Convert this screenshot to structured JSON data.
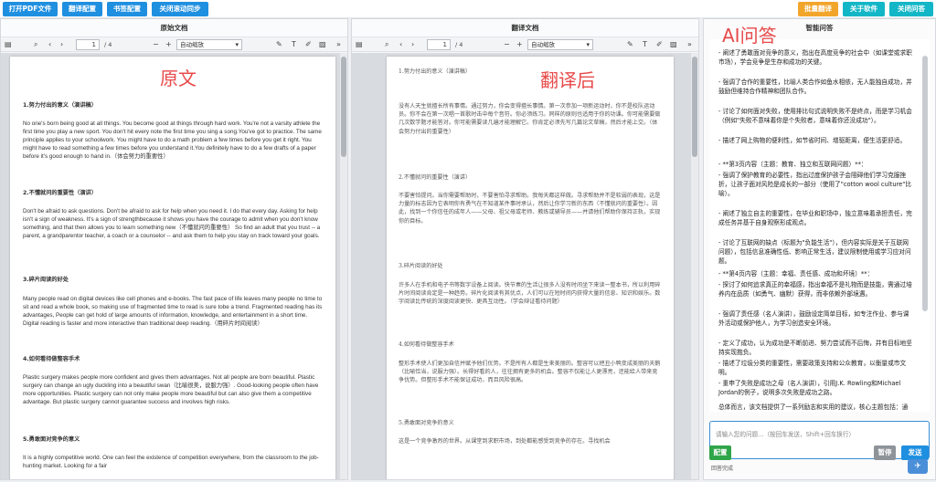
{
  "toolbar": {
    "open_pdf": "打开PDF文件",
    "translate_config": "翻译配置",
    "ai_config": "书签配置",
    "sync_scroll": "关闭滚动同步",
    "batch_translate": "批量翻译",
    "about": "关于软件",
    "close_qa": "关闭问答"
  },
  "panels": {
    "original_title": "原始文档",
    "translated_title": "翻译文档",
    "qa_title": "智能问答"
  },
  "viewer": {
    "page_number": "1",
    "page_total": "/ 4",
    "zoom": "自动缩放",
    "original_page_number": "1",
    "original_page_total": "/ 4",
    "original_zoom": "自动缩放"
  },
  "annotations": {
    "original_label": "原文",
    "translated_label": "翻译后",
    "ai_label": "AI问答"
  },
  "original_doc": {
    "h1": "1.努力付出的意义（演讲稿）",
    "p1": "No one's born being good at all things. You become good at things through hard work. You're not a varsity athlete the first time you play a new sport. You don't hit every note the first time you sing a song.You've got to practice. The same principle applies to your schoolwork. You might have to do a math problem a few times before you get it right. You might have to read something a few times before you understand it.You definitely have to do a few drafts of a paper before it's good enough to hand in.（体会努力的重要性）",
    "h2": "2.不懂就问的重要性（演讲）",
    "p2": "Don't be afraid to ask questions. Don't be afraid to ask for help when you need it. I do that every day. Asking for help isn't a sign of weakness. It's a sign of strengthbecause it shows you have the courage to admit when you don't know something, and that then allows you to learn something new（不懂就问的重要性） So find an adult that you trust -- a parent, a grandparentor teacher, a coach or a counselor -- and ask them to help you stay on track toward your goals.",
    "h3": "3.碎片阅读的好处",
    "p3": "Many people read on digital devices like cell phones and e-books. The fast pace of life leaves many people no time to sit and read a whole book, so making use of fragmented time to read is sure tobe a trend. Fragmented reading has its advantages, People can get hold of large amounts of information, knowledge, and entertainment in a short time. Digital reading is faster and more interactive than traditional deep reading.（用碎片时间阅读）",
    "h4": "4.如何看待做整容手术",
    "p4": "Plastic surgery makes people more confident and gives them advantages. Not all people are born beautiful. Plastic surgery can change an ugly duckling into a beautiful swan（比喻很美，说服力强）. Good-looking people often have more opportunities. Plastic surgery can not only make people more beautiful but can also give them a competitive advantage. But plastic surgery cannot guarantee success and involves high risks.",
    "h5": "5.勇敢面对竞争的意义",
    "p5": "It is a highly competitive world. One can feel the existence of competition everywhere, from the classroom to the job-hunting market. Looking for a fair"
  },
  "translated_doc": {
    "h1": "1.努力付出的意义（演讲稿）",
    "p1": "没有人天生就擅长所有事情。通过努力，你会变得擅长事情。第一次参加一项新运动时，你不是校队运动员。你不会在第一次唱一首歌时击中每个音符。你必须练习。同样的原则也适用于你的功课。你可能需要做几次数学题才能答对。你可能需要读几遍才能理解它。你肯定必须先写几篇论文草稿，然后才能上交。（体会努力付出的重要性）",
    "h2": "2.不懂就问的重要性（演讲）",
    "p2": "不要害怕提问。当你需要帮助时，不要害怕寻求帮助。我每天都这样做。寻求帮助并不是软弱的表现，这是力量的标志因为它表明你有勇气在不知道某件事时承认，然后让你学习新的东西（不懂就问的重要性）。因此，找到一个你信任的成年人——父母、祖父母或老师、教练或辅导员——并请他们帮助你保持正轨，实现你的目标。",
    "h3": "3.碎片阅读的好处",
    "p3": "许多人在手机和电子书等数字设备上阅读。快节奏的生活让很多人没有时间坐下来读一整本书，所以利用碎片时间阅读肯定是一种趋势。碎片化阅读有其优点，人们可以在短时间内获得大量的信息、知识和娱乐。数字阅读比传统的深度阅读更快、更具互动性。（学会辩证看待问题）",
    "h4": "4.如何看待做整容手术",
    "p4": "整形手术使人们更加自信并赋予他们优势。不是所有人都是生来美丽的。整容可以把丑小鸭变成美丽的天鹅（比喻恰当，说服力强）。长得好看的人，往往拥有更多的机会。整容不仅能让人更漂亮，还能给人带来竞争优势。但整形手术不能保证成功，而且风险很高。",
    "h5": "5.勇敢面对竞争的意义",
    "p5": "这是一个竞争激烈的世界。从课堂到求职市场，到处都能感受到竞争的存在。寻找机会"
  },
  "qa": {
    "p1": "- 阐述了勇敢面对竞争的意义，指出在高度竞争的社会中（如课堂或求职市场），学会竞争是生存和成功的关键。",
    "p2": "- 强调了合作的重要性，比喻人类合作如鱼水相依，无人能独自成功，并鼓励但维持合作精神和团队合作。",
    "p3": "- 讨论了如何面对失败，使用排比句式说明失败不是终点，而是学习机会（例如\"失败不意味着你是个失败者，意味着你还没成功\"）。",
    "p4": "- 描述了网上购物的便利性，如节省时间、增驱距离，便生活更舒适。",
    "p5": "- **第3页内容（主题：教育、独立和互联网问题）**：",
    "p6": "- 强调了保护教育的必要性，指出过度保护孩子会阻碍他们学习克服挫折，让孩子面对风险是成长的一部分（使用了\"cotton wool culture\"比喻）。",
    "p7": "- 阐述了独立自主的重要性，在毕业和职场中，独立意味着承担责任，完成任务并基于自身观察形成观点。",
    "p8": "- 讨论了互联网的缺点（标题为\"负能生活\"），但内容实际是关于互联网问题），包括信息准确性低、影响正常生活，建议限制使用或学习应对问题。",
    "p9": "- **第4页内容（主题：幸福、责任感、成功和坏境）**：",
    "p10": "- 探讨了如何追求真正的幸福感，指出幸福不是礼物而是技能，需通过培养内在品质（如勇气、幽默）获得，而非依赖外部境遇。",
    "p11": "- 强调了责任感（名人演讲），鼓励设定简单目标，如专注作业、参与课外活动或保护他人，为学习创造安全环境。",
    "p12": "- 定义了成功，认为成功是不断前进、努力尝试而不后悔，并有目标地坚持实现抱负。",
    "p13": "- 描述了垃圾分类的重要性，需要政策支持和公众教育，以衡量或市文明。",
    "p14": "- 重申了失败是成功之母（名人演讲），引用J.K. Rowling和Michael Jordan的例子，说明多次失败是成功之路。",
    "p15": "总体而言，该文档提供了一系列励志和实用的建议，核心主题包括：通过努力和坚持提升技能、勇敢面对挑战（如竞争和失败）、培养合作与独立精神，追求内在幸福和责任感，以及对现代生活现象（如互联网、网购、整容）的辩证思考。这些内容旨在鼓励个人成长和积极生活态度。",
    "input_placeholder": "请输入您的问题...（按回车发送，Shift+回车换行）",
    "config_btn": "配置",
    "stop_btn": "暂停",
    "send_btn": "发送",
    "status": "回答完成"
  }
}
